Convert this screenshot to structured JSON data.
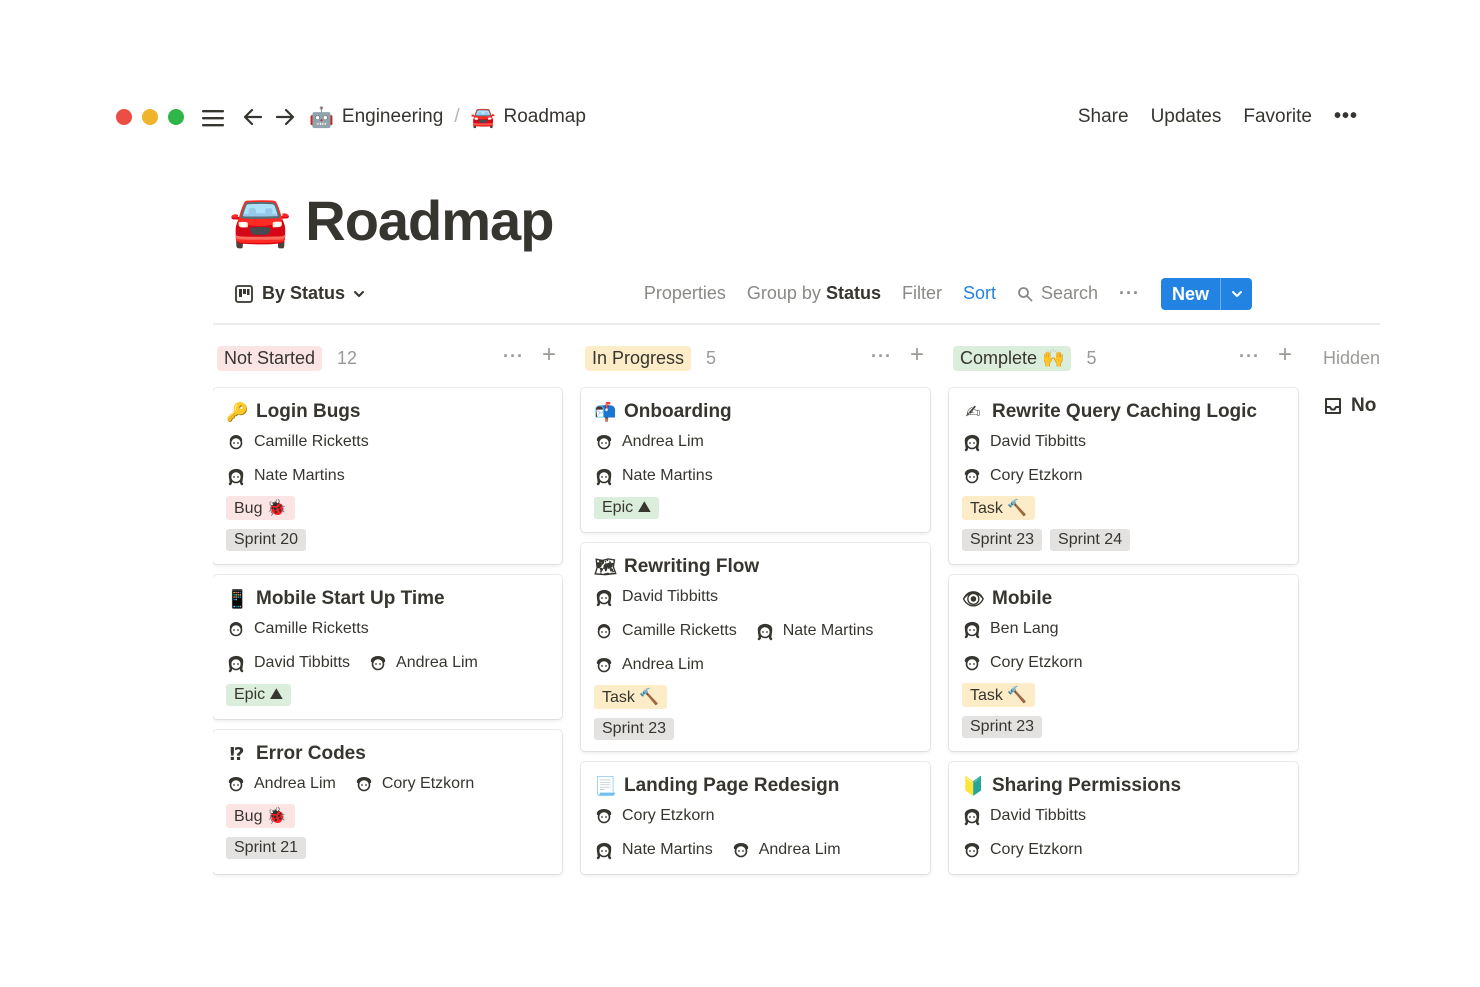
{
  "breadcrumb": [
    {
      "icon": "🤖",
      "label": "Engineering"
    },
    {
      "icon": "🚘",
      "label": "Roadmap"
    }
  ],
  "breadcrumb_separator": "/",
  "top_actions": {
    "share": "Share",
    "updates": "Updates",
    "favorite": "Favorite",
    "more": "•••"
  },
  "page": {
    "icon": "🚘",
    "title": "Roadmap"
  },
  "view": {
    "name": "By Status",
    "properties": "Properties",
    "group_by_prefix": "Group by",
    "group_by_value": "Status",
    "filter": "Filter",
    "sort": "Sort",
    "search": "Search",
    "more": "···",
    "new": "New"
  },
  "colors": {
    "accent": "#2383e2",
    "not_started": "#fbe4e4",
    "in_progress": "#fdecc8",
    "complete": "#dbeddb"
  },
  "columns": [
    {
      "label": "Not Started",
      "count": "12",
      "cards": [
        {
          "icon": "🔑",
          "title": "Login Bugs",
          "people_rows": [
            [
              "Camille Ricketts"
            ],
            [
              "Nate Martins"
            ]
          ],
          "type": {
            "label": "Bug 🐞",
            "kind": "bug"
          },
          "sprints": [
            "Sprint 20"
          ]
        },
        {
          "icon": "📱",
          "title": "Mobile Start Up Time",
          "people_rows": [
            [
              "Camille Ricketts"
            ],
            [
              "David Tibbitts",
              "Andrea Lim"
            ]
          ],
          "type": {
            "label": "Epic ⛰",
            "kind": "epic"
          },
          "sprints": []
        },
        {
          "icon": "⁉",
          "title": "Error Codes",
          "people_rows": [
            [
              "Andrea Lim",
              "Cory Etzkorn"
            ]
          ],
          "type": {
            "label": "Bug 🐞",
            "kind": "bug"
          },
          "sprints": [
            "Sprint 21"
          ]
        }
      ]
    },
    {
      "label": "In Progress",
      "count": "5",
      "cards": [
        {
          "icon": "📬",
          "title": "Onboarding",
          "people_rows": [
            [
              "Andrea Lim"
            ],
            [
              "Nate Martins"
            ]
          ],
          "type": {
            "label": "Epic ⛰",
            "kind": "epic"
          },
          "sprints": []
        },
        {
          "icon": "🗺",
          "title": "Rewriting Flow",
          "people_rows": [
            [
              "David Tibbitts"
            ],
            [
              "Camille Ricketts",
              "Nate Martins"
            ],
            [
              "Andrea Lim"
            ]
          ],
          "type": {
            "label": "Task 🔨",
            "kind": "task"
          },
          "sprints": [
            "Sprint 23"
          ]
        },
        {
          "icon": "📃",
          "title": "Landing Page Redesign",
          "people_rows": [
            [
              "Cory Etzkorn"
            ],
            [
              "Nate Martins",
              "Andrea Lim"
            ]
          ],
          "type": null,
          "sprints": []
        }
      ]
    },
    {
      "label": "Complete 🙌",
      "count": "5",
      "cards": [
        {
          "icon": "✍",
          "title": "Rewrite Query Caching Logic",
          "people_rows": [
            [
              "David Tibbitts"
            ],
            [
              "Cory Etzkorn"
            ]
          ],
          "type": {
            "label": "Task 🔨",
            "kind": "task"
          },
          "sprints": [
            "Sprint 23",
            "Sprint 24"
          ]
        },
        {
          "icon": "👁",
          "title": "Mobile",
          "people_rows": [
            [
              "Ben Lang"
            ],
            [
              "Cory Etzkorn"
            ]
          ],
          "type": {
            "label": "Task 🔨",
            "kind": "task"
          },
          "sprints": [
            "Sprint 23"
          ]
        },
        {
          "icon": "🔰",
          "title": "Sharing Permissions",
          "people_rows": [
            [
              "David Tibbitts"
            ],
            [
              "Cory Etzkorn"
            ]
          ],
          "type": null,
          "sprints": []
        }
      ]
    }
  ],
  "hidden": {
    "label": "Hidden",
    "item": "No"
  }
}
